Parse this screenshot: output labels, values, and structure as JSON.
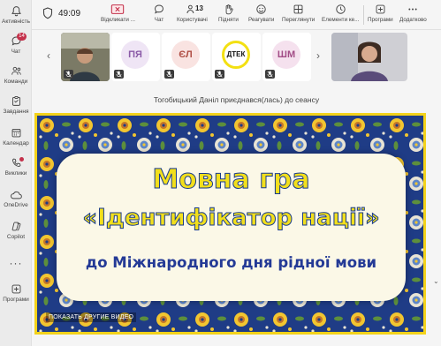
{
  "rail": {
    "items": [
      {
        "label": "Активність"
      },
      {
        "label": "Чат",
        "badge": "14"
      },
      {
        "label": "Команди"
      },
      {
        "label": "Завдання"
      },
      {
        "label": "Календар"
      },
      {
        "label": "Виклики"
      },
      {
        "label": "OneDrive"
      },
      {
        "label": "Copilot"
      },
      {
        "label": "Програми"
      }
    ],
    "more": "···"
  },
  "topbar": {
    "timer": "49:09",
    "buttons": [
      {
        "label": "Відкликати ...",
        "icon": "share-stop-icon"
      },
      {
        "label": "Чат",
        "icon": "chat-icon"
      },
      {
        "label": "Користувачі",
        "icon": "people-icon",
        "count": "13"
      },
      {
        "label": "Підняти",
        "icon": "raise-hand-icon"
      },
      {
        "label": "Реагувати",
        "icon": "react-icon"
      },
      {
        "label": "Переглянути",
        "icon": "view-icon"
      },
      {
        "label": "Елементи ке...",
        "icon": "rooms-icon"
      },
      {
        "label": "Програми",
        "icon": "apps-icon"
      },
      {
        "label": "Додатково",
        "icon": "more-icon"
      }
    ]
  },
  "participants": [
    {
      "initials": "ПЯ",
      "bg": "#efe5f5",
      "fg": "#8a5aa7"
    },
    {
      "initials": "ЄЛ",
      "bg": "#f9e3e1",
      "fg": "#b04f45"
    },
    {
      "initials": "ДТЕК",
      "bg": "#ffffff",
      "fg": "#111111"
    },
    {
      "initials": "ШМ",
      "bg": "#f5e1ee",
      "fg": "#a24c86"
    }
  ],
  "notice": "Тогобицький Даніл приєднався(лась) до сеансу",
  "shared": {
    "title_line1": "Мовна гра",
    "title_line2": "«Ідентифікатор нації»",
    "subtitle": "до Міжнародного дня рідної мови",
    "show_video": "ПОКАЗАТЬ ДРУГИЕ ВИДЕО"
  },
  "colors": {
    "accent": "#5b5fc7",
    "title_fill": "#f2df1c",
    "title_stroke": "#173a8d",
    "frame": "#f3d21b"
  }
}
